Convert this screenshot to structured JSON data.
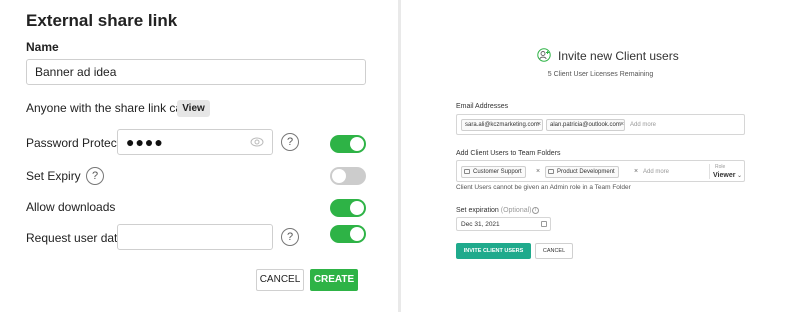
{
  "share_dialog": {
    "title": "External share link",
    "name_label": "Name",
    "name_value": "Banner ad idea",
    "share_text": "Anyone with the share link can",
    "permission_button": "View",
    "password_label": "Password Protect",
    "password_mask": "●●●●",
    "password_toggle": "on",
    "expiry_label": "Set Expiry",
    "expiry_toggle": "off",
    "downloads_label": "Allow downloads",
    "downloads_toggle": "on",
    "request_label": "Request user data",
    "request_toggle": "on",
    "help_glyph": "?",
    "cancel_label": "CANCEL",
    "create_label": "CREATE"
  },
  "invite_panel": {
    "title": "Invite new Client users",
    "licenses_text": "5 Client User Licenses Remaining",
    "email_label": "Email Addresses",
    "emails": [
      "sara.ali@kczmarketing.com",
      "alan.patricia@outlook.com"
    ],
    "add_more": "Add more",
    "folders_label": "Add Client Users to Team Folders",
    "folders": [
      "Customer Support",
      "Product Development"
    ],
    "role_label": "Role",
    "role_value": "Viewer",
    "role_note": "Client Users cannot be given an Admin role in a Team Folder",
    "expiration_label": "Set expiration",
    "expiration_optional": "(Optional)",
    "expiration_value": "Dec 31, 2021",
    "invite_button": "INVITE CLIENT USERS",
    "cancel_button": "CANCEL"
  },
  "colors": {
    "accent_green": "#2eb346",
    "teal_button": "#1faa8c",
    "toggle_off": "#cccccc"
  },
  "icons": [
    "eye-icon",
    "help-icon",
    "user-plus-icon",
    "folder-icon",
    "info-icon",
    "calendar-icon",
    "close-icon",
    "chevron-down-icon"
  ]
}
